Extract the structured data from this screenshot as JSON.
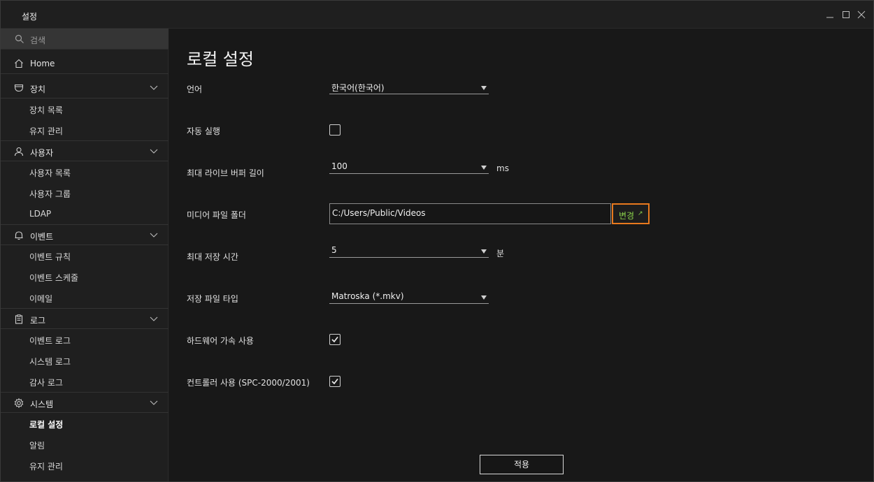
{
  "window": {
    "title": "설정",
    "controls": {
      "minimize": "minimize-icon",
      "maximize": "maximize-icon",
      "close": "close-icon"
    }
  },
  "sidebar": {
    "search_placeholder": "검색",
    "home": "Home",
    "groups": [
      {
        "label": "장치",
        "icon": "device-icon",
        "items": [
          "장치 목록",
          "유지 관리"
        ]
      },
      {
        "label": "사용자",
        "icon": "user-icon",
        "items": [
          "사용자 목록",
          "사용자 그룹",
          "LDAP"
        ]
      },
      {
        "label": "이벤트",
        "icon": "bell-icon",
        "items": [
          "이벤트 규칙",
          "이벤트 스케줄",
          "이메일"
        ]
      },
      {
        "label": "로그",
        "icon": "clipboard-icon",
        "items": [
          "이벤트 로그",
          "시스템 로그",
          "감사 로그"
        ]
      },
      {
        "label": "시스템",
        "icon": "gear-icon",
        "items": [
          "로컬 설정",
          "알림",
          "유지 관리"
        ]
      }
    ],
    "active_item": "로컬 설정"
  },
  "content": {
    "title": "로컬 설정",
    "language": {
      "label": "언어",
      "value": "한국어(한국어)"
    },
    "autostart": {
      "label": "자동 실행",
      "checked": false
    },
    "live_buffer": {
      "label": "최대 라이브 버퍼 길이",
      "value": "100",
      "unit": "ms"
    },
    "media_folder": {
      "label": "미디어 파일 폴더",
      "value": "C:/Users/Public/Videos",
      "button": "변경",
      "button_icon": "↗"
    },
    "max_record_time": {
      "label": "최대 저장 시간",
      "value": "5",
      "unit": "분"
    },
    "file_type": {
      "label": "저장 파일 타입",
      "value": "Matroska (*.mkv)"
    },
    "hw_accel": {
      "label": "하드웨어 가속 사용",
      "checked": true
    },
    "controller": {
      "label": "컨트롤러 사용 (SPC-2000/2001)",
      "checked": true
    },
    "apply": "적용"
  },
  "colors": {
    "accent_border": "#e8791e",
    "accent_text": "#8bd24a",
    "background": "#181818"
  }
}
